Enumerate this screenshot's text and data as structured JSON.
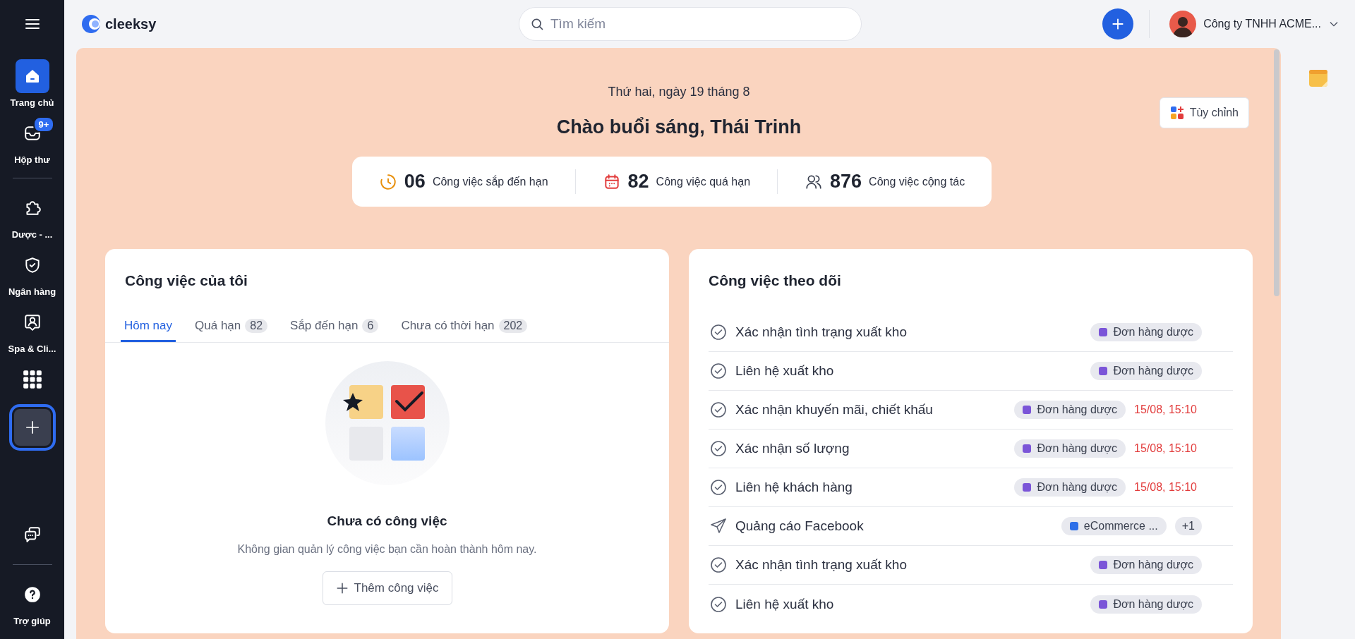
{
  "sidebar": {
    "items": [
      {
        "kind": "home",
        "label": "Trang chủ",
        "selected": true
      },
      {
        "kind": "inbox",
        "label": "Hộp thư",
        "selected": false,
        "badge": "9+"
      },
      {
        "kind": "divider"
      },
      {
        "kind": "puzzle",
        "label": "Dược - ...",
        "selected": false
      },
      {
        "kind": "shield",
        "label": "Ngân hàng",
        "selected": false
      },
      {
        "kind": "contact",
        "label": "Spa & Cli...",
        "selected": false
      },
      {
        "kind": "grid",
        "selected": false
      },
      {
        "kind": "add",
        "selected": false,
        "focused": true
      }
    ],
    "bottom_items": [
      {
        "kind": "chat",
        "selected": false
      },
      {
        "kind": "divider"
      },
      {
        "kind": "help",
        "label": "Trợ giúp",
        "selected": false
      }
    ]
  },
  "header": {
    "logo": "cleeksy",
    "search": {
      "placeholder": "Tìm kiếm"
    },
    "company": "Công ty TNHH ACME..."
  },
  "home": {
    "date": "Thứ hai, ngày 19 tháng 8",
    "greeting": "Chào buổi sáng, Thái Trinh",
    "customize_button": "Tùy chỉnh",
    "stats": [
      {
        "kind": "clock",
        "value": "06",
        "label": "Công việc sắp đến hạn"
      },
      {
        "kind": "calendar",
        "value": "82",
        "label": "Công việc quá hạn"
      },
      {
        "kind": "users",
        "value": "876",
        "label": "Công việc cộng tác"
      }
    ]
  },
  "my_tasks": {
    "title": "Công việc của tôi",
    "tabs": [
      {
        "label": "Hôm nay",
        "selected": true
      },
      {
        "label": "Quá hạn",
        "count": "82",
        "selected": false
      },
      {
        "label": "Sắp đến hạn",
        "count": "6",
        "selected": false
      },
      {
        "label": "Chưa có thời hạn",
        "count": "202",
        "selected": false
      }
    ],
    "empty_title": "Chưa có công việc",
    "empty_text": "Không gian quản lý công việc bạn cần hoàn thành hôm nay.",
    "add_button": "Thêm công việc"
  },
  "followed_tasks": {
    "title": "Công việc theo dõi",
    "rows": [
      {
        "kind": "task",
        "title": "Xác nhận tình trạng xuất kho",
        "tag": "Đơn hàng dược",
        "color": "#7b55d8"
      },
      {
        "kind": "task",
        "title": "Liên hệ xuất kho",
        "tag": "Đơn hàng dược",
        "color": "#7b55d8"
      },
      {
        "kind": "task",
        "title": "Xác nhận khuyến mãi, chiết khấu",
        "tag": "Đơn hàng dược",
        "color": "#7b55d8",
        "due": "15/08, 15:10"
      },
      {
        "kind": "task",
        "title": "Xác nhận số lượng",
        "tag": "Đơn hàng dược",
        "color": "#7b55d8",
        "due": "15/08, 15:10"
      },
      {
        "kind": "task",
        "title": "Liên hệ khách hàng",
        "tag": "Đơn hàng dược",
        "color": "#7b55d8",
        "due": "15/08, 15:10"
      },
      {
        "kind": "campaign",
        "title": "Quảng cáo Facebook",
        "tag": "eCommerce ...",
        "color": "#2d6fe8",
        "extra": "+1"
      },
      {
        "kind": "task",
        "title": "Xác nhận tình trạng xuất kho",
        "tag": "Đơn hàng dược",
        "color": "#7b55d8"
      },
      {
        "kind": "task",
        "title": "Liên hệ xuất kho",
        "tag": "Đơn hàng dược",
        "color": "#7b55d8"
      }
    ]
  }
}
